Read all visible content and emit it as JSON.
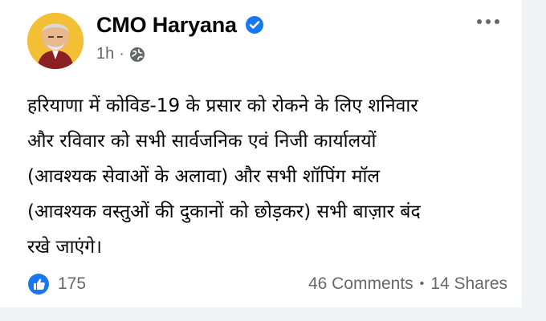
{
  "post": {
    "author": "CMO Haryana",
    "time": "1h",
    "icons": {
      "verified": "verified-badge-icon",
      "audience": "globe-icon",
      "more": "more-options-icon",
      "like": "like-reaction-icon"
    },
    "body_lines": [
      "हरियाणा में कोविड-19 के प्रसार को रोकने के लिए शनिवार",
      "और रविवार को सभी सार्वजनिक एवं निजी कार्यालयों",
      "(आवश्यक सेवाओं के अलावा) और सभी शॉपिंग मॉल",
      "(आवश्यक वस्तुओं की दुकानों को छोड़कर) सभी बाज़ार बंद",
      "रखे जाएंगे।"
    ],
    "reactions_count": "175",
    "comments": "46 Comments",
    "shares": "14 Shares"
  },
  "colors": {
    "text": "#050505",
    "secondary": "#65676b",
    "facebook_blue": "#1877f2",
    "avatar_bg": "#f4c236"
  }
}
